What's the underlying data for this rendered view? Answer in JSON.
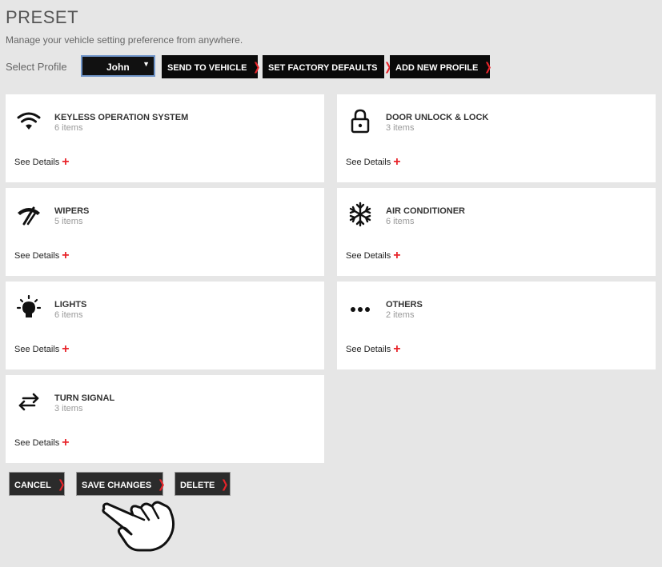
{
  "page": {
    "title": "PRESET",
    "subtitle": "Manage your vehicle setting preference from anywhere."
  },
  "profile": {
    "label": "Select Profile",
    "selected": "John",
    "caret": "▼"
  },
  "actions": {
    "send": "SEND TO VEHICLE",
    "factory": "SET FACTORY DEFAULTS",
    "add": "ADD NEW PROFILE",
    "chevron": "❯"
  },
  "cards": [
    {
      "title": "KEYLESS OPERATION SYSTEM",
      "count": "6 items",
      "details": "See Details",
      "icon": "wifi-icon"
    },
    {
      "title": "DOOR UNLOCK & LOCK",
      "count": "3 items",
      "details": "See Details",
      "icon": "lock-icon"
    },
    {
      "title": "WIPERS",
      "count": "5 items",
      "details": "See Details",
      "icon": "wiper-icon"
    },
    {
      "title": "AIR CONDITIONER",
      "count": "6 items",
      "details": "See Details",
      "icon": "snowflake-icon"
    },
    {
      "title": "LIGHTS",
      "count": "6 items",
      "details": "See Details",
      "icon": "light-bulb-icon"
    },
    {
      "title": "OTHERS",
      "count": "2 items",
      "details": "See Details",
      "icon": "more-dots-icon"
    },
    {
      "title": "TURN SIGNAL",
      "count": "3 items",
      "details": "See Details",
      "icon": "swap-arrows-icon"
    }
  ],
  "plus_symbol": "+",
  "footer": {
    "cancel": "CANCEL",
    "save": "SAVE CHANGES",
    "delete": "DELETE"
  },
  "colors": {
    "accent": "#e8242a",
    "button_bg": "#0a0a0a",
    "background": "#e6e6e6"
  }
}
